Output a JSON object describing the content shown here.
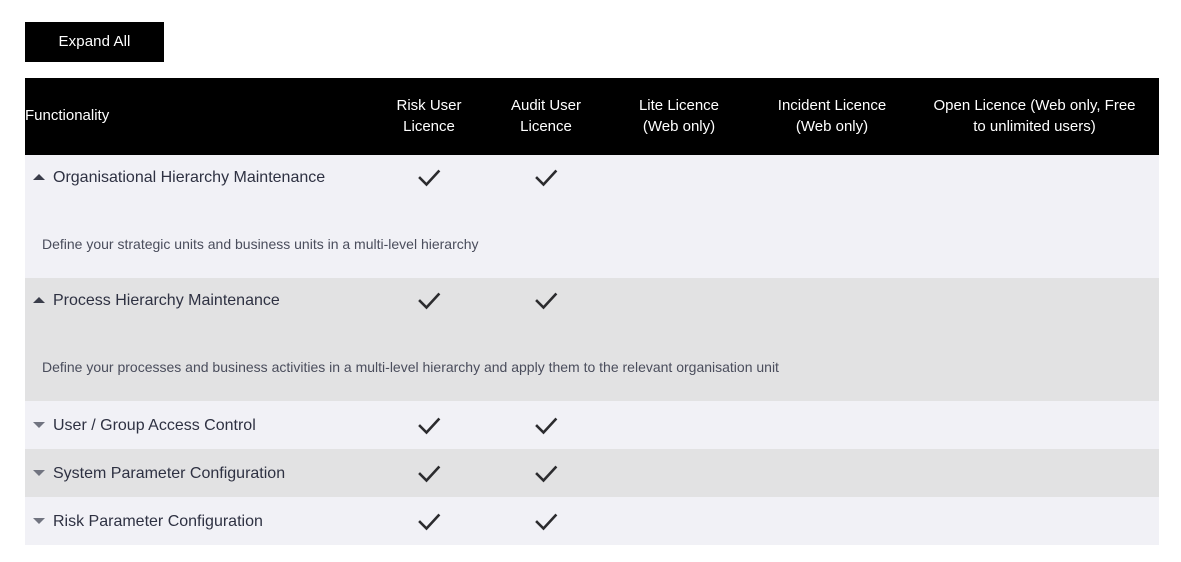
{
  "toolbar": {
    "expand_all_label": "Expand All"
  },
  "table": {
    "columns": [
      {
        "key": "functionality",
        "label": "Functionality"
      },
      {
        "key": "risk",
        "label": "Risk User\nLicence",
        "line1": "Risk User",
        "line2": "Licence"
      },
      {
        "key": "audit",
        "label": "Audit User\nLicence",
        "line1": "Audit User",
        "line2": "Licence"
      },
      {
        "key": "lite",
        "label": "Lite Licence\n(Web only)",
        "line1": "Lite Licence",
        "line2": "(Web only)"
      },
      {
        "key": "incident",
        "label": "Incident Licence\n(Web only)",
        "line1": "Incident Licence",
        "line2": "(Web only)"
      },
      {
        "key": "open",
        "label": "Open Licence (Web only, Free to unlimited users)",
        "line1": "Open Licence (Web only, Free",
        "line2": "to unlimited users)"
      }
    ],
    "rows": [
      {
        "label": "Organisational Hierarchy Maintenance",
        "expanded": true,
        "state_icon": "caret-up-icon",
        "description": "Define your strategic units and business units in a multi-level hierarchy",
        "checks": {
          "risk": true,
          "audit": true,
          "lite": false,
          "incident": false,
          "open": false
        },
        "band": "light"
      },
      {
        "label": "Process Hierarchy Maintenance",
        "expanded": true,
        "state_icon": "caret-up-icon",
        "description": "Define your processes and business activities in a multi-level hierarchy and apply them to the relevant organisation unit",
        "checks": {
          "risk": true,
          "audit": true,
          "lite": false,
          "incident": false,
          "open": false
        },
        "band": "dark"
      },
      {
        "label": "User / Group Access Control",
        "expanded": false,
        "state_icon": "caret-down-icon",
        "description": "",
        "checks": {
          "risk": true,
          "audit": true,
          "lite": false,
          "incident": false,
          "open": false
        },
        "band": "light"
      },
      {
        "label": "System Parameter Configuration",
        "expanded": false,
        "state_icon": "caret-down-icon",
        "description": "",
        "checks": {
          "risk": true,
          "audit": true,
          "lite": false,
          "incident": false,
          "open": false
        },
        "band": "dark"
      },
      {
        "label": "Risk Parameter Configuration",
        "expanded": false,
        "state_icon": "caret-down-icon",
        "description": "",
        "checks": {
          "risk": true,
          "audit": true,
          "lite": false,
          "incident": false,
          "open": false
        },
        "band": "light"
      }
    ]
  },
  "colors": {
    "header_bg": "#000000",
    "header_text": "#ffffff",
    "band_light": "#f1f1f6",
    "band_dark": "#e2e2e3",
    "label_text": "#2e3142",
    "desc_text": "#4a4d5c",
    "check_mark": "#2b2b2e"
  }
}
